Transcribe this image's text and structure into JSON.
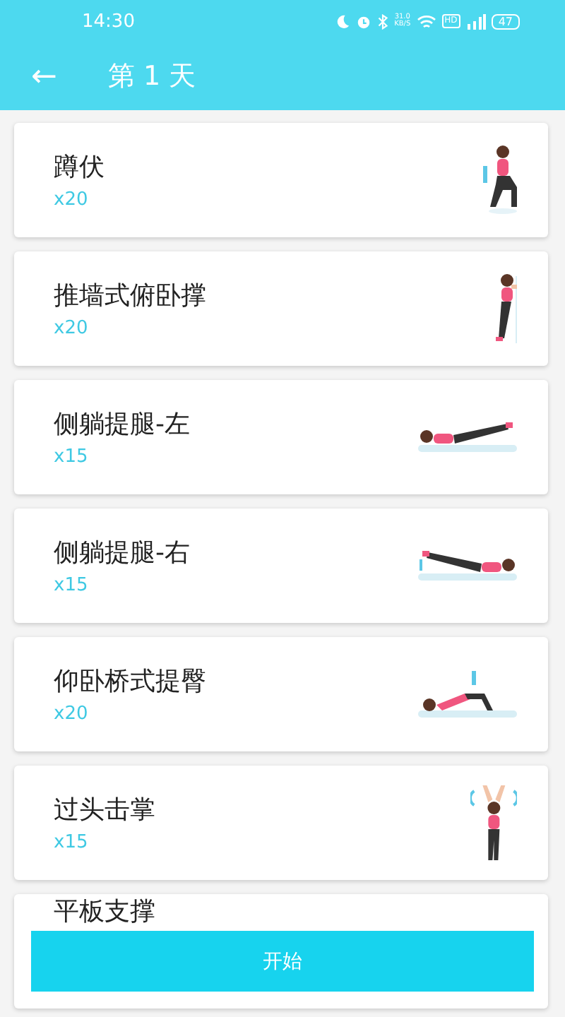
{
  "status_bar": {
    "time": "14:30",
    "speed_value": "31.0",
    "speed_unit": "KB/S",
    "network_badge": "HD",
    "battery": "47"
  },
  "header": {
    "back": "←",
    "title": "第 1 天"
  },
  "exercises": [
    {
      "name": "蹲伏",
      "count": "x20",
      "kind": "picture"
    },
    {
      "name": "推墙式俯卧撑",
      "count": "x20",
      "kind": "picture"
    },
    {
      "name": "侧躺提腿-左",
      "count": "x15",
      "kind": "picture"
    },
    {
      "name": "侧躺提腿-右",
      "count": "x15",
      "kind": "picture"
    },
    {
      "name": "仰卧桥式提臀",
      "count": "x20",
      "kind": "picture"
    },
    {
      "name": "过头击掌",
      "count": "x15",
      "kind": "picture"
    },
    {
      "name": "平板支撑"
    }
  ],
  "start_button": {
    "label": "开始"
  }
}
